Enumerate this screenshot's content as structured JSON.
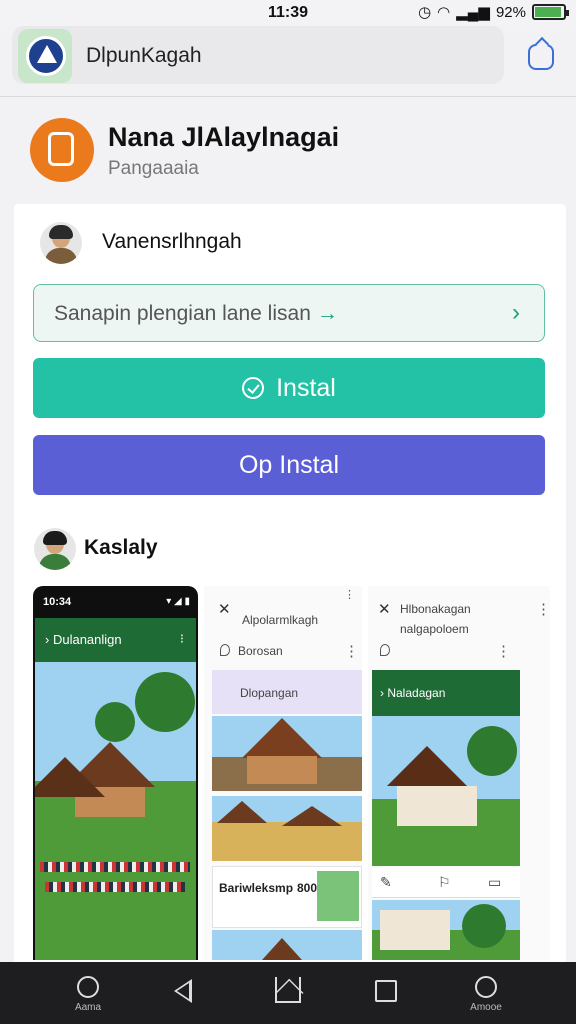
{
  "status_bar": {
    "time": "11:39",
    "battery": "92%",
    "battery_fraction": 0.92
  },
  "browser": {
    "url_text": "DlpunKagah"
  },
  "app": {
    "name": "Nana JlAlaylnagai",
    "subtitle": "Pangaaaia"
  },
  "reviewer": {
    "name": "Vanensrlhngah"
  },
  "search": {
    "placeholder": "Sanapin plengian lane lisan",
    "arrow": "→",
    "chevron": "›"
  },
  "buttons": {
    "install": "Instal",
    "open": "Op Instal"
  },
  "developer": {
    "name": "Kaslaly"
  },
  "screenshots": {
    "s1": {
      "status_time": "10:34",
      "status_icons": "▾ ◢ ▮",
      "title": "Dulananlign",
      "menu": "⁝"
    },
    "s2": {
      "close": "✕",
      "title": "Alpolarmlkagh",
      "more": "⋮",
      "loc": "Borosan",
      "header": "Dlopangan",
      "card_title": "Bariwleksmp",
      "card_num": "800"
    },
    "s3": {
      "close": "✕",
      "title": "Hlbonakagan",
      "subtitle": "nalgapoloem",
      "more": "⋮",
      "bar_title": "Naladagan"
    }
  },
  "nav": {
    "left_label": "Aama",
    "right_label": "Amooe"
  },
  "colors": {
    "install": "#23c2a6",
    "open": "#5a5fd6",
    "accent": "#1f9d7a",
    "app_icon": "#ea7a1c"
  }
}
